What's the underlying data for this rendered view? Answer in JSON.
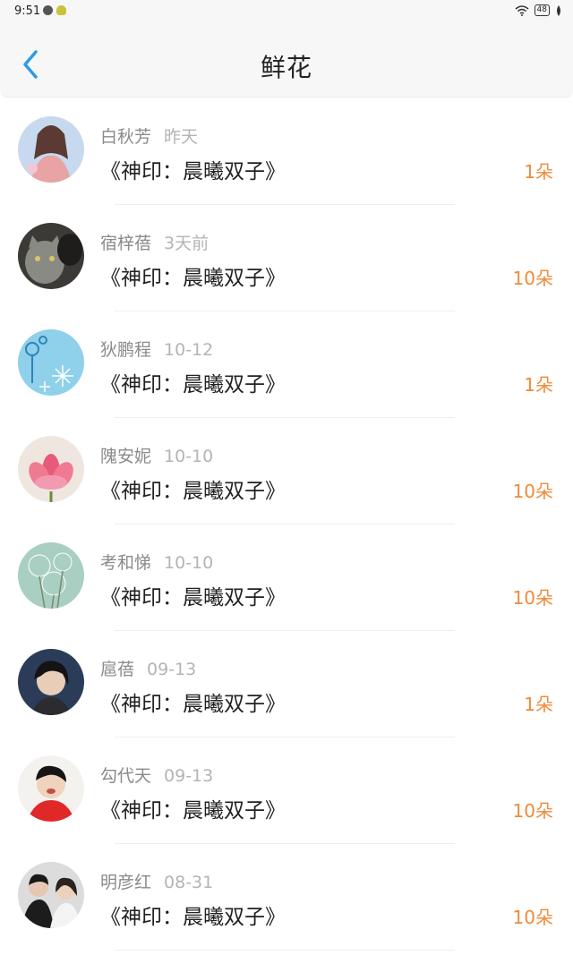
{
  "status_bar": {
    "time": "9:51",
    "battery": "48",
    "app_icons": [
      "wechat-icon",
      "bulb-icon"
    ]
  },
  "header": {
    "title": "鲜花",
    "back_icon": "chevron-left-icon",
    "accent_color": "#2f9be8"
  },
  "colors": {
    "count": "#ef8a3a",
    "name": "#8a8a8a",
    "time": "#b4b4b4"
  },
  "rows": [
    {
      "name": "白秋芳",
      "time": "昨天",
      "book": "《神印：晨曦双子》",
      "count": "1朵"
    },
    {
      "name": "宿梓蓓",
      "time": "3天前",
      "book": "《神印：晨曦双子》",
      "count": "10朵"
    },
    {
      "name": "狄鹏程",
      "time": "10-12",
      "book": "《神印：晨曦双子》",
      "count": "1朵"
    },
    {
      "name": "隗安妮",
      "time": "10-10",
      "book": "《神印：晨曦双子》",
      "count": "10朵"
    },
    {
      "name": "考和悌",
      "time": "10-10",
      "book": "《神印：晨曦双子》",
      "count": "10朵"
    },
    {
      "name": "扈蓓",
      "time": "09-13",
      "book": "《神印：晨曦双子》",
      "count": "1朵"
    },
    {
      "name": "勾代天",
      "time": "09-13",
      "book": "《神印：晨曦双子》",
      "count": "10朵"
    },
    {
      "name": "明彦红",
      "time": "08-31",
      "book": "《神印：晨曦双子》",
      "count": "10朵"
    }
  ]
}
